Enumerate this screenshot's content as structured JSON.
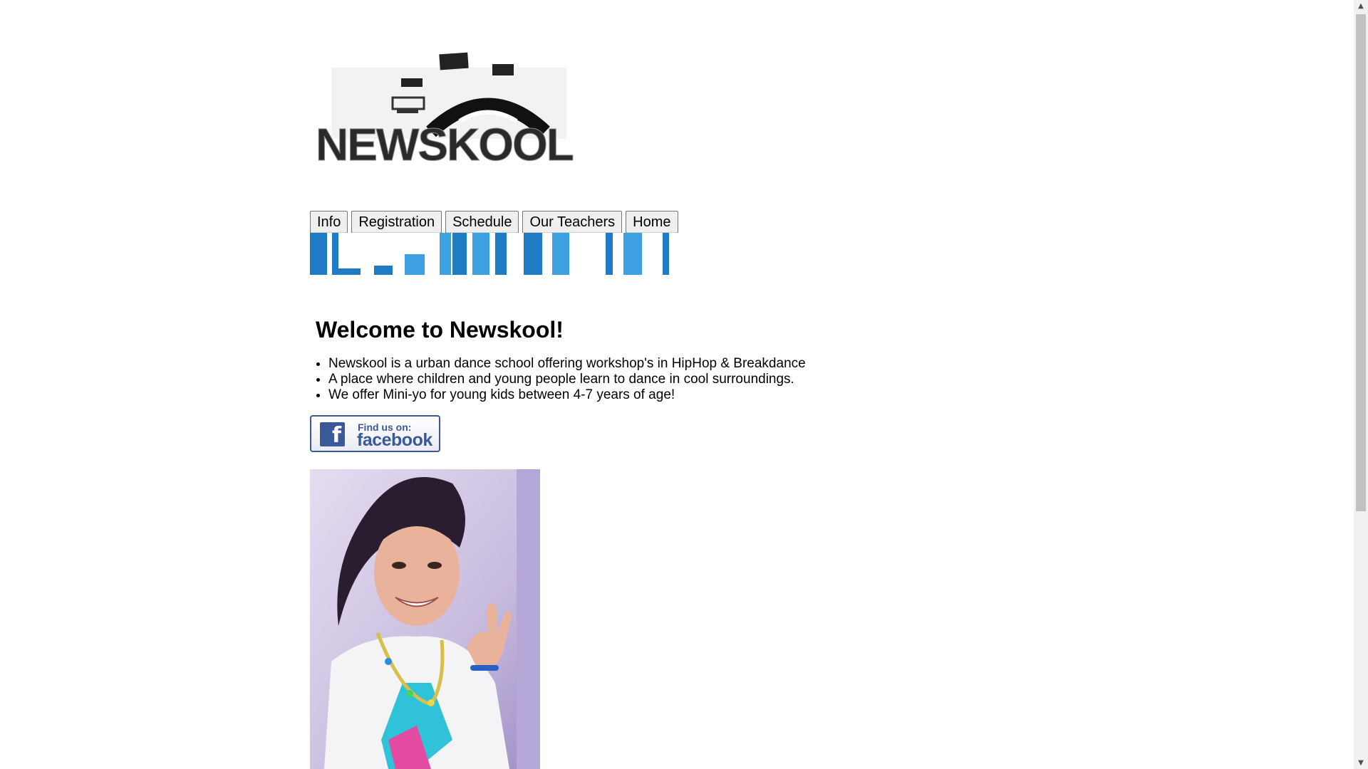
{
  "logo": {
    "text": "NEWSKOOL"
  },
  "nav": {
    "items": [
      "Info",
      "Registration",
      "Schedule",
      "Our Teachers",
      "Home"
    ]
  },
  "main": {
    "heading": "Welcome to Newskool!",
    "bullets": [
      "Newskool is a urban dance school offering workshop's in HipHop & Breakdance",
      "A place where children and young people learn to dance in cool surroundings.",
      "We offer Mini-yo for young kids between 4-7 years of age!"
    ]
  },
  "facebook": {
    "line1": "Find us on:",
    "line2": "facebook",
    "icon": "f"
  },
  "scrollbar": {
    "up_icon": "▲",
    "down_icon": "▼"
  },
  "colors": {
    "banner_blue": "#1f7bc4",
    "facebook_blue": "#3b5998"
  }
}
